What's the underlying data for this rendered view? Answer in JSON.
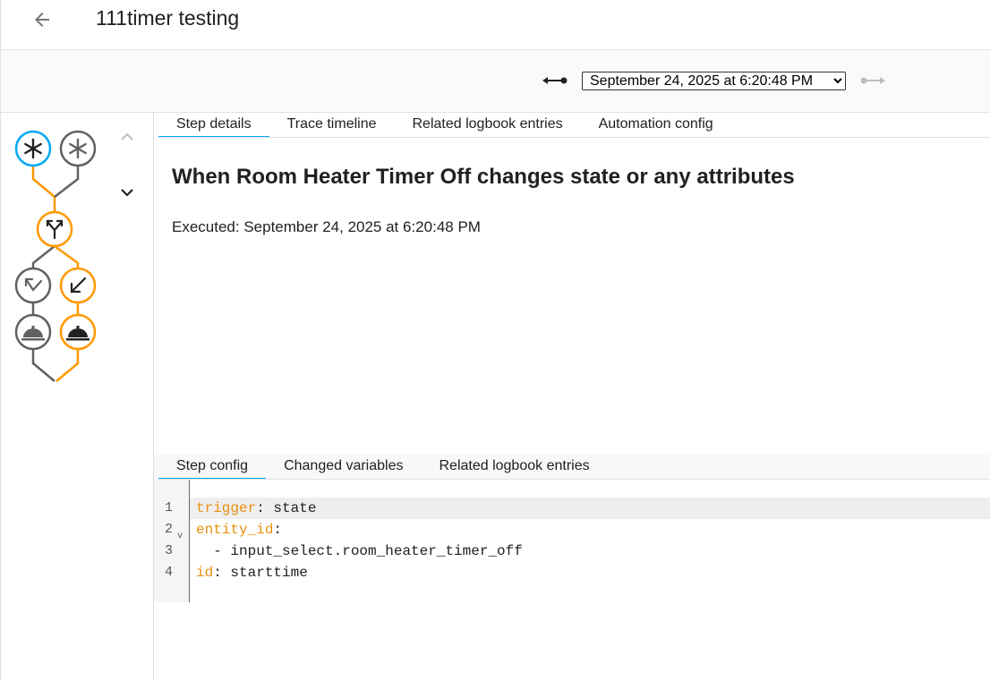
{
  "header": {
    "title": "111timer testing",
    "back_icon": "arrow-left-icon"
  },
  "toolbar": {
    "prev_icon": "previous-trace-icon",
    "next_icon": "next-trace-icon",
    "selected_trace": "September 24, 2025 at 6:20:48 PM",
    "trace_options": [
      "September 24, 2025 at 6:20:48 PM"
    ]
  },
  "graph": {
    "nodes": [
      {
        "name": "trigger-node-1",
        "icon": "asterisk-icon",
        "state": "active"
      },
      {
        "name": "trigger-node-2",
        "icon": "asterisk-icon",
        "state": "inactive"
      },
      {
        "name": "choose-node",
        "icon": "call-split-icon",
        "state": "executed"
      },
      {
        "name": "option-node-1",
        "icon": "arrow-up-left-check-icon",
        "state": "inactive"
      },
      {
        "name": "option-node-2",
        "icon": "arrow-down-left-icon",
        "state": "executed"
      },
      {
        "name": "action-node-1",
        "icon": "room-service-icon",
        "state": "inactive"
      },
      {
        "name": "action-node-2",
        "icon": "room-service-icon",
        "state": "executed"
      }
    ],
    "colors": {
      "active": "#03a9f4",
      "executed": "#ff9800",
      "inactive": "#616161"
    }
  },
  "tabs": [
    {
      "label": "Step details",
      "active": true
    },
    {
      "label": "Trace timeline",
      "active": false
    },
    {
      "label": "Related logbook entries",
      "active": false
    },
    {
      "label": "Automation config",
      "active": false
    }
  ],
  "step": {
    "title": "When Room Heater Timer Off changes state or any attributes",
    "executed": "Executed: September 24, 2025 at 6:20:48 PM"
  },
  "subtabs": [
    {
      "label": "Step config",
      "active": true
    },
    {
      "label": "Changed variables",
      "active": false
    },
    {
      "label": "Related logbook entries",
      "active": false
    }
  ],
  "editor": {
    "lines": [
      {
        "num": "1",
        "key": "trigger",
        "rest": ": state"
      },
      {
        "num": "2",
        "key": "entity_id",
        "rest": ":"
      },
      {
        "num": "3",
        "key": "",
        "rest": "  - input_select.room_heater_timer_off"
      },
      {
        "num": "4",
        "key": "id",
        "rest": ": starttime"
      }
    ]
  }
}
